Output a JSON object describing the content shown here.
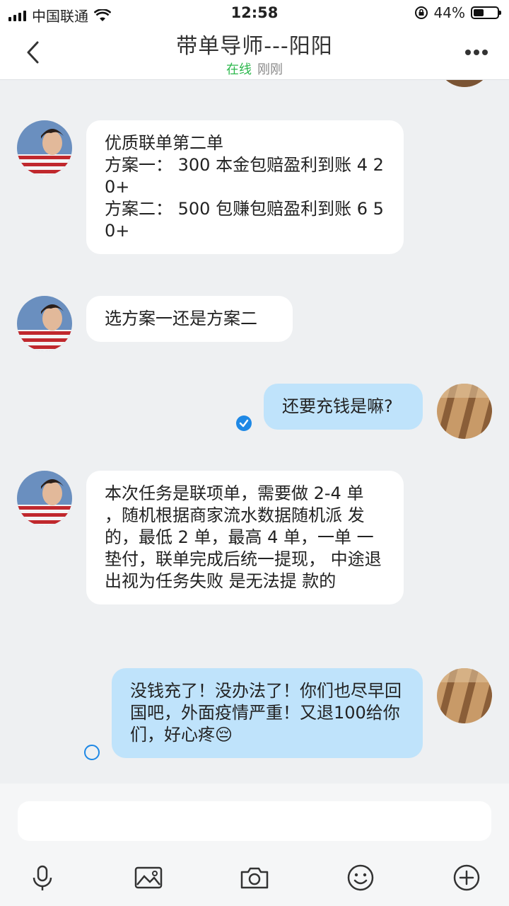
{
  "status_bar": {
    "carrier": "中国联通",
    "time": "12:58",
    "battery": "44%",
    "battery_level": 0.44
  },
  "header": {
    "title": "带单导师---阳阳",
    "status": "在线",
    "last_seen": "刚刚"
  },
  "messages": [
    {
      "side": "in",
      "text": "优质联单第二单\n方案一： 300 本金包赔盈利到账 4 20+\n方案二： 500 包赚包赔盈利到账 6 50+"
    },
    {
      "side": "in",
      "text": "选方案一还是方案二"
    },
    {
      "side": "out",
      "text": "还要充钱是嘛?",
      "status": "read"
    },
    {
      "side": "in",
      "text": "本次任务是联项单，需要做 2-4 单 ，随机根据商家流水数据随机派 发的，最低 2 单，最高 4 单，一单 一垫付，联单完成后统一提现， 中途退出视为任务失败 是无法提 款的"
    },
    {
      "side": "out",
      "text": "没钱充了！没办法了！你们也尽早回国吧，外面疫情严重！又退100给你们，好心疼😔",
      "status": "sending"
    }
  ],
  "input": {
    "placeholder": ""
  },
  "toolbar": [
    "microphone-icon",
    "image-icon",
    "camera-icon",
    "emoji-icon",
    "plus-icon"
  ],
  "colors": {
    "online": "#2db84d",
    "outgoing_bubble": "#bfe3fb",
    "accent": "#1e88e5"
  }
}
